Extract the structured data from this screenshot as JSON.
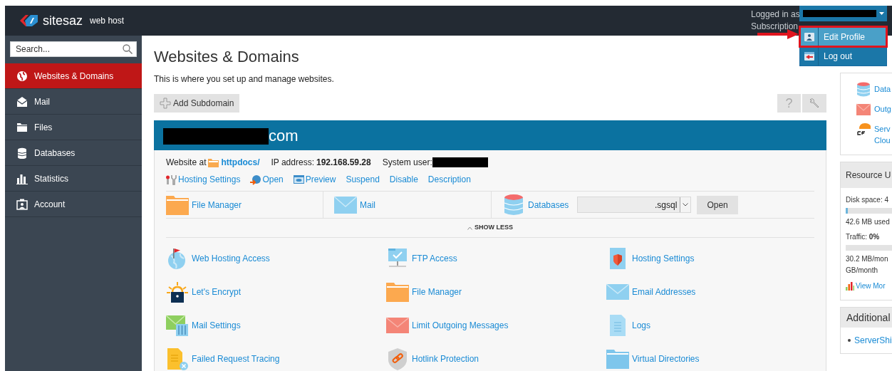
{
  "header": {
    "logo_text": "sitesaz",
    "logo_subtitle": "web host",
    "logged_in_label": "Logged in as",
    "subscription_label": "Subscription"
  },
  "user_menu": {
    "items": [
      {
        "label": "Edit Profile",
        "selected": true
      },
      {
        "label": "Log out",
        "selected": false
      }
    ]
  },
  "sidebar": {
    "search": {
      "placeholder": "Search..."
    },
    "items": [
      {
        "label": "Websites & Domains",
        "selected": true
      },
      {
        "label": "Mail",
        "selected": false
      },
      {
        "label": "Files",
        "selected": false
      },
      {
        "label": "Databases",
        "selected": false
      },
      {
        "label": "Statistics",
        "selected": false
      },
      {
        "label": "Account",
        "selected": false
      }
    ]
  },
  "main": {
    "title": "Websites & Domains",
    "description": "This is where you set up and manage websites.",
    "add_button": "Add Subdomain",
    "help_button": "?",
    "domain": {
      "name_suffix": "com",
      "website_at_label": "Website at",
      "docroot": "httpdocs/",
      "ip_label": "IP address:",
      "ip": "192.168.59.28",
      "system_user_label": "System user:",
      "links": [
        "Hosting Settings",
        "Open",
        "Preview",
        "Suspend",
        "Disable",
        "Description"
      ],
      "tools": [
        "File Manager",
        "Mail",
        "Databases"
      ],
      "database_select": {
        "value": ".sgsql"
      },
      "open_button": "Open",
      "show_less": "SHOW LESS",
      "features": [
        "Web Hosting Access",
        "FTP Access",
        "Hosting Settings",
        "Let's Encrypt",
        "File Manager",
        "Email Addresses",
        "Mail Settings",
        "Limit Outgoing Messages",
        "Logs",
        "Failed Request Tracing",
        "Hotlink Protection",
        "Virtual Directories"
      ]
    }
  },
  "right": {
    "quick_links": [
      {
        "lines": [
          "Data"
        ]
      },
      {
        "lines": [
          "Outg"
        ]
      },
      {
        "lines": [
          "Serv",
          "Clou"
        ]
      }
    ],
    "resources": {
      "title": "Resource U",
      "disk_label": "Disk space: 4",
      "disk_bar": {
        "level": 0.04
      },
      "disk_reading": "42.6 MB used",
      "traffic_label": "Traffic: **0%**",
      "traffic_bar": {
        "level": 0
      },
      "traffic_reading": [
        "30.2 MB/mon",
        "GB/month"
      ],
      "view_more": "View Mor"
    },
    "additional": {
      "title": "Additional",
      "items": [
        "ServerShi"
      ]
    }
  }
}
